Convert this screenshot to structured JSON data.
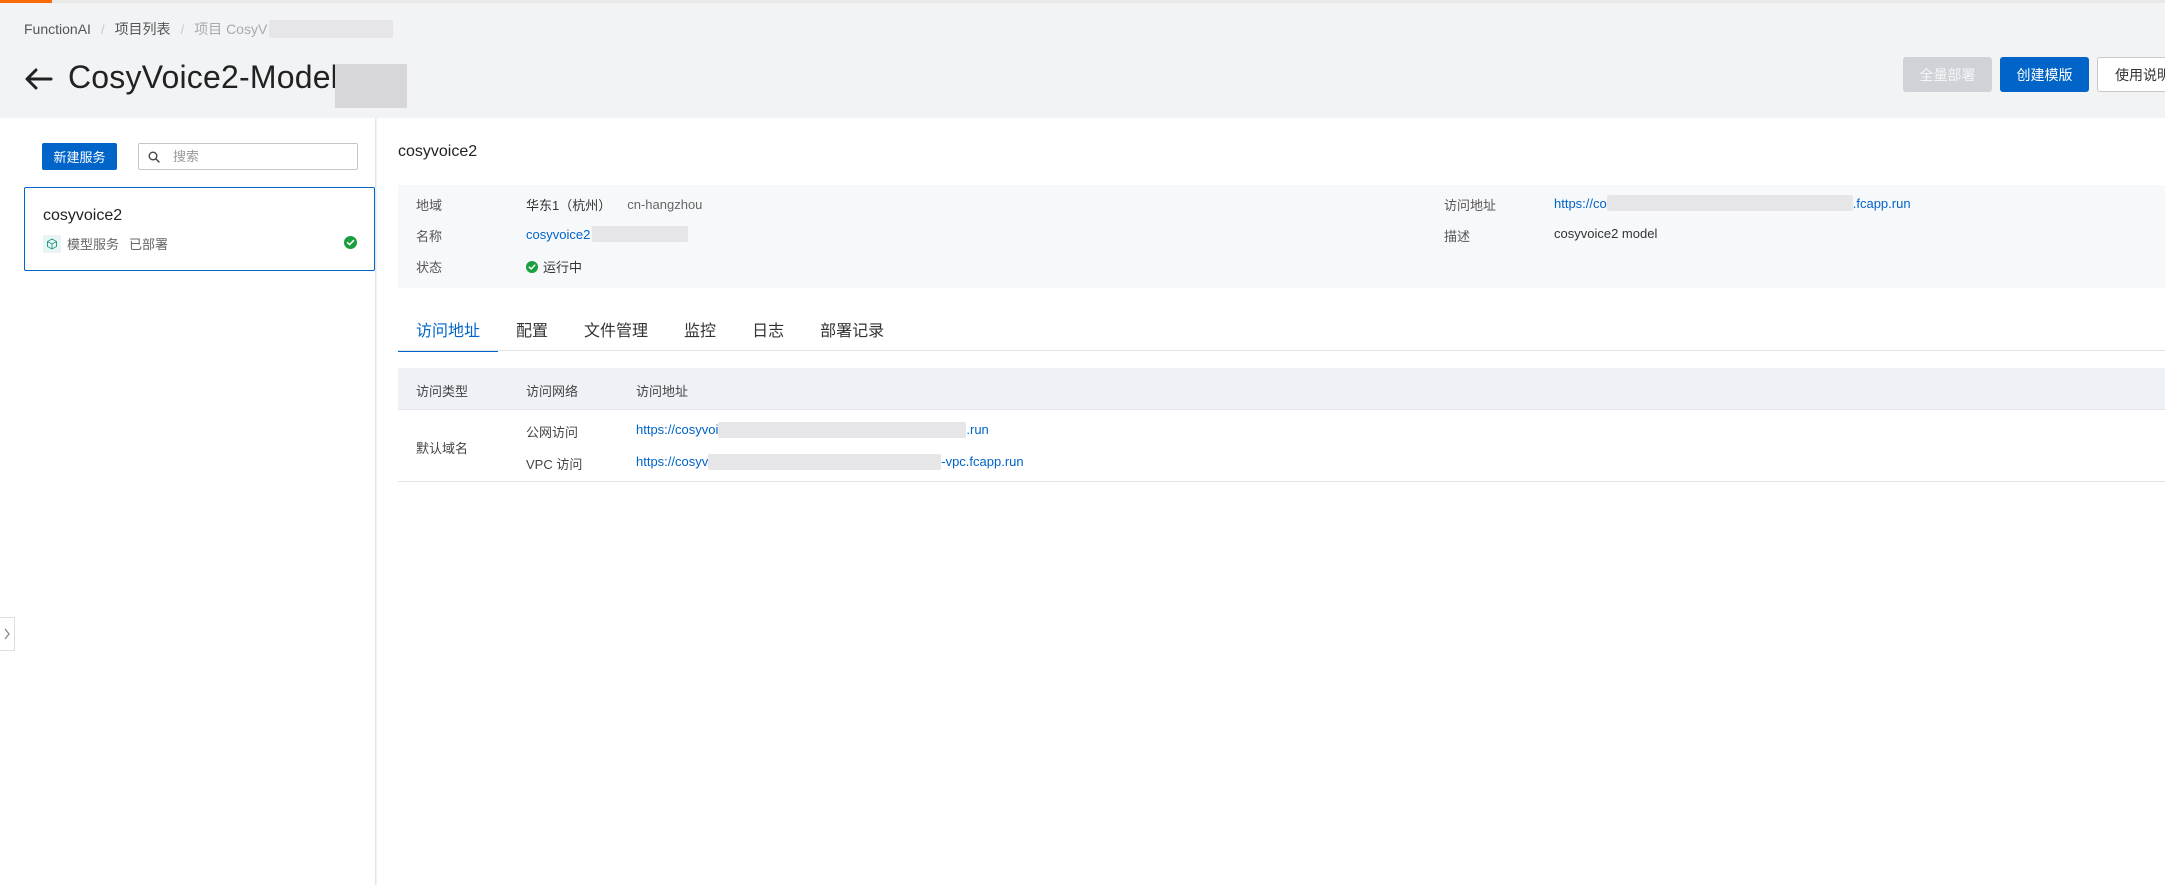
{
  "breadcrumb": {
    "items": [
      "FunctionAI",
      "项目列表",
      "项目 CosyV"
    ]
  },
  "header": {
    "title": "CosyVoice2-Model",
    "buttons": {
      "deploy_all": "全量部署",
      "create_template": "创建模版",
      "guide": "使用说明"
    }
  },
  "sidebar": {
    "new_service_label": "新建服务",
    "search_placeholder": "搜索",
    "services": [
      {
        "name": "cosyvoice2",
        "type": "模型服务",
        "status": "已部署"
      }
    ]
  },
  "detail": {
    "service_title": "cosyvoice2",
    "info": {
      "region_label": "地域",
      "region_value": "华东1（杭州）",
      "region_code": "cn-hangzhou",
      "name_label": "名称",
      "name_value": "cosyvoice2",
      "status_label": "状态",
      "status_value": "运行中",
      "url_label": "访问地址",
      "url_prefix": "https://co",
      "url_suffix": ".fcapp.run",
      "desc_label": "描述",
      "desc_value": "cosyvoice2 model"
    },
    "tabs": [
      "访问地址",
      "配置",
      "文件管理",
      "监控",
      "日志",
      "部署记录"
    ],
    "active_tab": "访问地址",
    "table": {
      "headers": [
        "访问类型",
        "访问网络",
        "访问地址"
      ],
      "row": {
        "type": "默认域名",
        "public_network": "公网访问",
        "public_url_prefix": "https://cosyvoi",
        "public_url_suffix": ".run",
        "vpc_network": "VPC 访问",
        "vpc_url_prefix": "https://cosyv",
        "vpc_url_suffix": "-vpc.fcapp.run"
      }
    }
  },
  "colors": {
    "primary": "#0064c8",
    "accent_orange": "#ff6a00",
    "success": "#1a9e3f"
  }
}
